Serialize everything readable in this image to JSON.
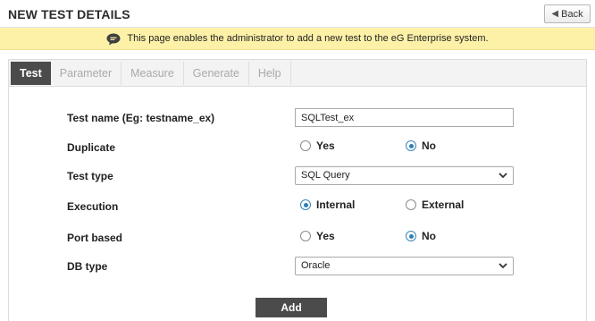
{
  "header": {
    "title": "NEW TEST DETAILS",
    "back_label": "Back"
  },
  "info_bar": {
    "icon": "chat-bubble-icon",
    "message": "This page enables the administrator to add a new test to the eG Enterprise system."
  },
  "tabs": [
    {
      "label": "Test",
      "active": true
    },
    {
      "label": "Parameter",
      "active": false
    },
    {
      "label": "Measure",
      "active": false
    },
    {
      "label": "Generate",
      "active": false
    },
    {
      "label": "Help",
      "active": false
    }
  ],
  "form": {
    "test_name": {
      "label": "Test name (Eg: testname_ex)",
      "value": "SQLTest_ex"
    },
    "duplicate": {
      "label": "Duplicate",
      "options": [
        "Yes",
        "No"
      ],
      "selected": "No"
    },
    "test_type": {
      "label": "Test type",
      "value": "SQL Query"
    },
    "execution": {
      "label": "Execution",
      "options": [
        "Internal",
        "External"
      ],
      "selected": "Internal"
    },
    "port_based": {
      "label": "Port based",
      "options": [
        "Yes",
        "No"
      ],
      "selected": "No"
    },
    "db_type": {
      "label": "DB type",
      "value": "Oracle"
    }
  },
  "actions": {
    "add_label": "Add"
  },
  "colors": {
    "info_bg": "#fdf1a8",
    "tab_active_bg": "#4b4b4b",
    "radio_accent": "#2d7fb3"
  }
}
